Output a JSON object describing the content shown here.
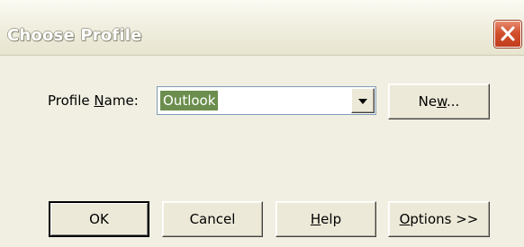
{
  "window": {
    "title": "Choose Profile"
  },
  "form": {
    "profile_label_prefix": "Profile ",
    "profile_label_mnemonic": "N",
    "profile_label_suffix": "ame:",
    "profile_value": "Outlook"
  },
  "buttons": {
    "new_prefix": "Ne",
    "new_mnemonic": "w",
    "new_suffix": "...",
    "ok": "OK",
    "cancel": "Cancel",
    "help_mnemonic": "H",
    "help_suffix": "elp",
    "options_mnemonic": "O",
    "options_suffix": "ptions >>"
  },
  "icons": {
    "close": "close-icon",
    "dropdown": "chevron-down-icon"
  },
  "colors": {
    "window_bg": "#f1efe2",
    "selection_bg": "#6b8e4e",
    "close_button": "#d2502d"
  }
}
